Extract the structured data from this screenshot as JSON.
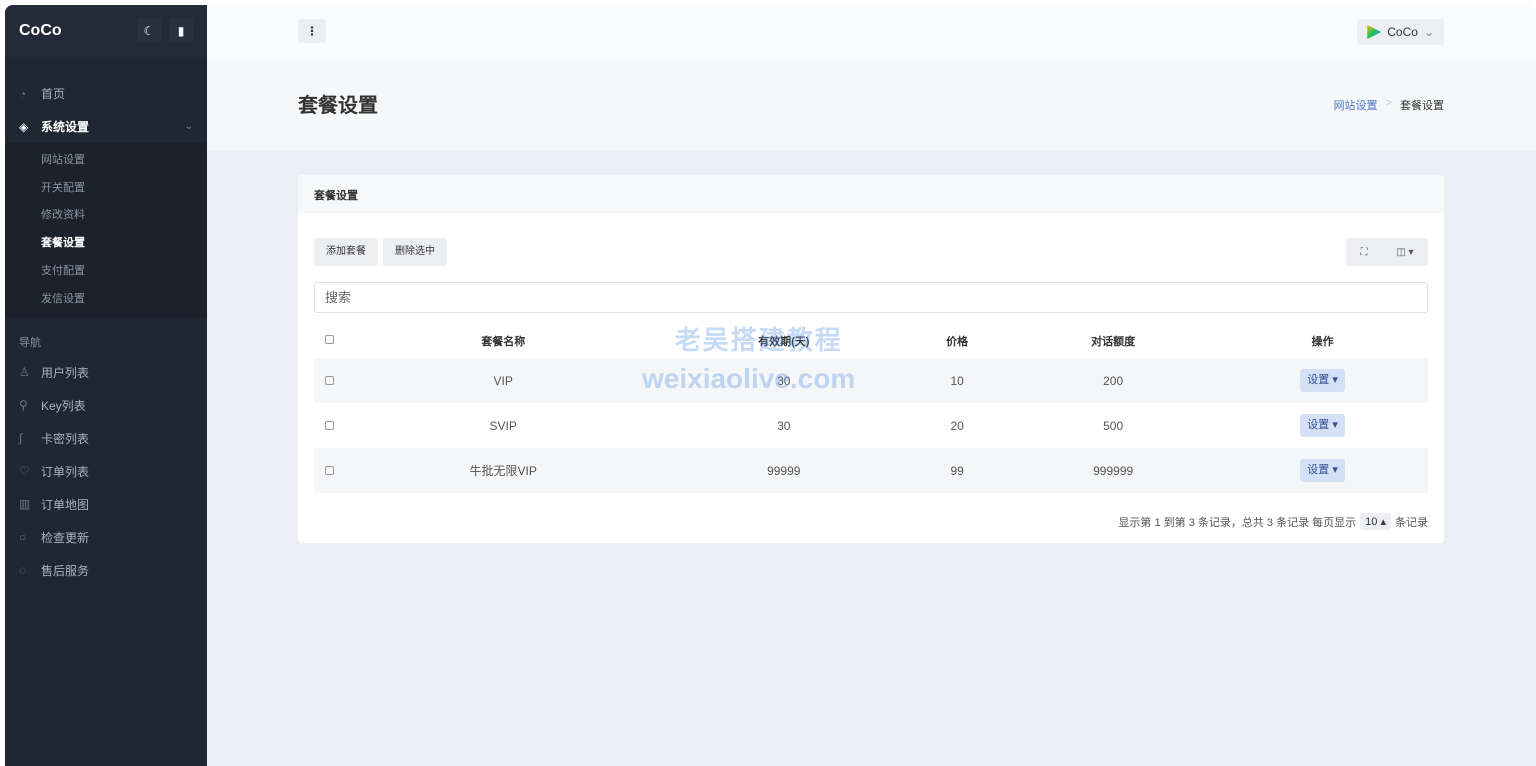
{
  "sidebar": {
    "brand": "CoCo",
    "items": [
      {
        "label": "首页",
        "icon": "dashboard-icon"
      },
      {
        "label": "系统设置",
        "icon": "layers-icon"
      }
    ],
    "sub": [
      "网站设置",
      "开关配置",
      "修改资料",
      "套餐设置",
      "支付配置",
      "发信设置"
    ],
    "nav_label": "导航",
    "nav": [
      {
        "label": "用户列表",
        "icon": "user-icon",
        "g": "♙"
      },
      {
        "label": "Key列表",
        "icon": "key-icon",
        "g": "⚲"
      },
      {
        "label": "卡密列表",
        "icon": "card-icon",
        "g": "∫"
      },
      {
        "label": "订单列表",
        "icon": "heart-icon",
        "g": "♡"
      },
      {
        "label": "订单地图",
        "icon": "map-icon",
        "g": "▥"
      },
      {
        "label": "检查更新",
        "icon": "refresh-icon",
        "g": "○"
      },
      {
        "label": "售后服务",
        "icon": "chat-icon",
        "g": "◌"
      }
    ]
  },
  "topbar": {
    "user": "CoCo"
  },
  "page": {
    "title": "套餐设置",
    "breadcrumb": [
      "网站设置",
      "套餐设置"
    ]
  },
  "card": {
    "title": "套餐设置",
    "add": "添加套餐",
    "delete": "删除选中",
    "search_placeholder": "搜索",
    "columns": [
      "套餐名称",
      "有效期(天)",
      "价格",
      "对话额度",
      "操作"
    ],
    "rows": [
      [
        "VIP",
        "30",
        "10",
        "200"
      ],
      [
        "SVIP",
        "30",
        "20",
        "500"
      ],
      [
        "牛批无限VIP",
        "99999",
        "99",
        "999999"
      ]
    ],
    "action": "设置",
    "pager": {
      "text": "显示第 1 到第 3 条记录，总共 3 条记录  每页显示",
      "size": "10",
      "suffix": "条记录"
    }
  },
  "watermark": [
    "老吴搭建教程",
    "weixiaolive.com"
  ]
}
